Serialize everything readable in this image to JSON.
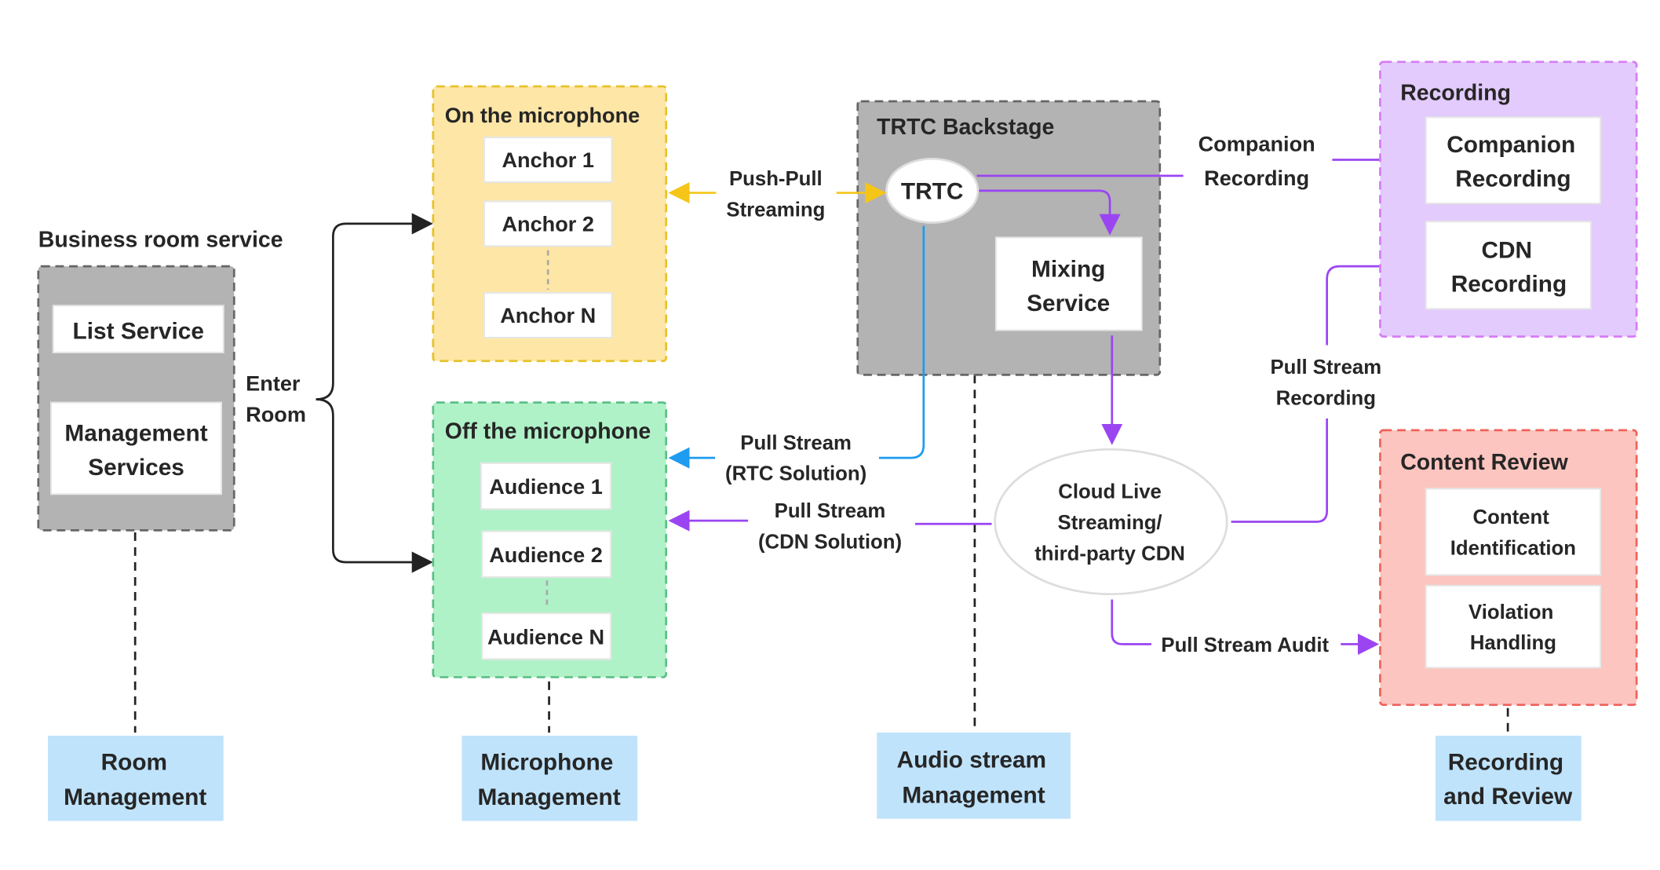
{
  "colors": {
    "purple": "#9b45f2",
    "blue": "#1e9cf0",
    "yellow": "#f5c518",
    "gray_box": "#b3b3b3",
    "yellow_box": "#fde6a6",
    "green_box": "#b0f2c8",
    "purple_box": "#e3cbfd",
    "red_box": "#fcc5bf",
    "footer_box": "#bfe3fb"
  },
  "business": {
    "title": "Business room service",
    "list_service": "List Service",
    "mgmt_1": "Management",
    "mgmt_2": "Services"
  },
  "enter_room": {
    "line1": "Enter",
    "line2": "Room"
  },
  "on_mic": {
    "title": "On the microphone",
    "items": [
      "Anchor 1",
      "Anchor 2",
      "Anchor N"
    ]
  },
  "off_mic": {
    "title": "Off the microphone",
    "items": [
      "Audience 1",
      "Audience 2",
      "Audience N"
    ]
  },
  "push_pull": {
    "line1": "Push-Pull",
    "line2": "Streaming"
  },
  "pull_rtc": {
    "line1": "Pull Stream",
    "line2": "(RTC Solution)"
  },
  "pull_cdn": {
    "line1": "Pull Stream",
    "line2": "(CDN Solution)"
  },
  "backstage": {
    "title": "TRTC Backstage",
    "trtc": "TRTC",
    "mixing_1": "Mixing",
    "mixing_2": "Service"
  },
  "cloud": {
    "line1": "Cloud Live",
    "line2": "Streaming/",
    "line3": "third-party CDN"
  },
  "companion_label": {
    "line1": "Companion",
    "line2": "Recording"
  },
  "pull_recording": {
    "line1": "Pull Stream",
    "line2": "Recording"
  },
  "pull_audit": "Pull Stream Audit",
  "recording": {
    "title": "Recording",
    "companion_1": "Companion",
    "companion_2": "Recording",
    "cdn_1": "CDN",
    "cdn_2": "Recording"
  },
  "review": {
    "title": "Content Review",
    "ident_1": "Content",
    "ident_2": "Identification",
    "viol_1": "Violation",
    "viol_2": "Handling"
  },
  "footer": {
    "room": [
      "Room",
      "Management"
    ],
    "mic": [
      "Microphone",
      "Management"
    ],
    "audio": [
      "Audio stream",
      "Management"
    ],
    "rec": [
      "Recording",
      "and Review"
    ]
  }
}
